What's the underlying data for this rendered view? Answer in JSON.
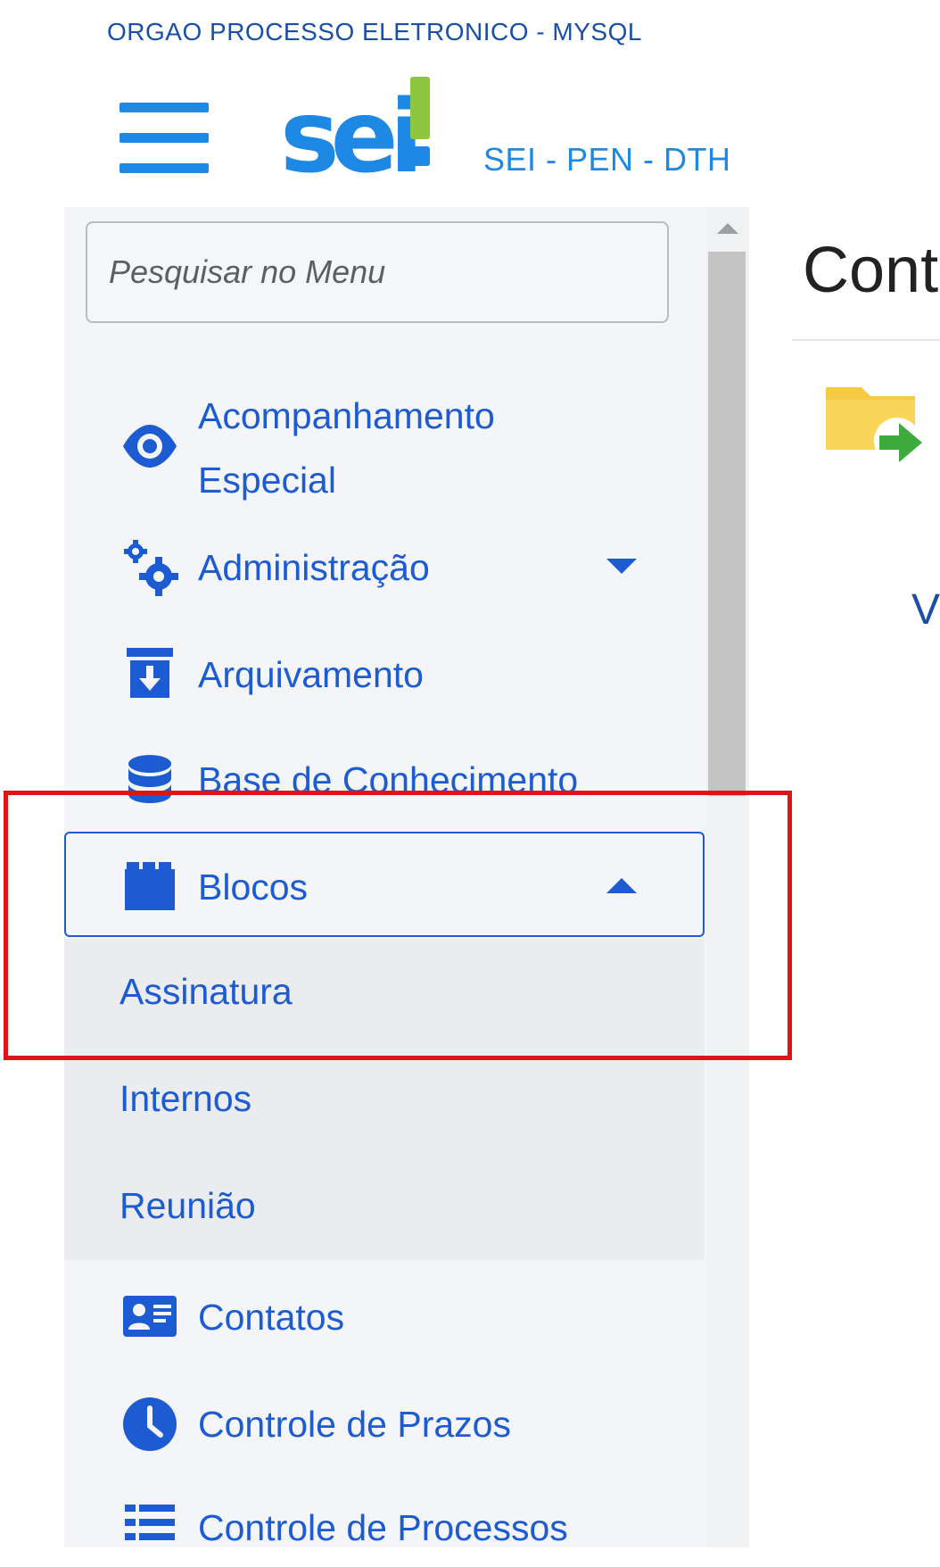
{
  "header": {
    "org_name": "ORGAO PROCESSO ELETRONICO - MYSQL",
    "logo_text": "sei!",
    "system_name": "SEI - PEN - DTH"
  },
  "sidebar": {
    "search_placeholder": "Pesquisar no Menu",
    "items": [
      {
        "label_line1": "Acompanhamento",
        "label_line2": "Especial",
        "icon": "eye-icon"
      },
      {
        "label": "Administração",
        "icon": "cogs-icon",
        "expandable": true,
        "expanded": false
      },
      {
        "label": "Arquivamento",
        "icon": "archive-icon"
      },
      {
        "label": "Base de Conhecimento",
        "icon": "database-icon"
      },
      {
        "label": "Blocos",
        "icon": "cubes-icon",
        "expandable": true,
        "expanded": true,
        "subitems": [
          "Assinatura",
          "Internos",
          "Reunião"
        ]
      },
      {
        "label": "Contatos",
        "icon": "contact-card-icon"
      },
      {
        "label": "Controle de Prazos",
        "icon": "clock-icon"
      },
      {
        "label": "Controle de Processos",
        "icon": "list-icon"
      }
    ]
  },
  "main": {
    "title_partial": "Cont",
    "letter_partial": "V"
  },
  "colors": {
    "accent": "#1c5bd1",
    "brand_blue": "#1e88e5",
    "brand_green": "#8dc63f",
    "highlight": "#e01414"
  }
}
